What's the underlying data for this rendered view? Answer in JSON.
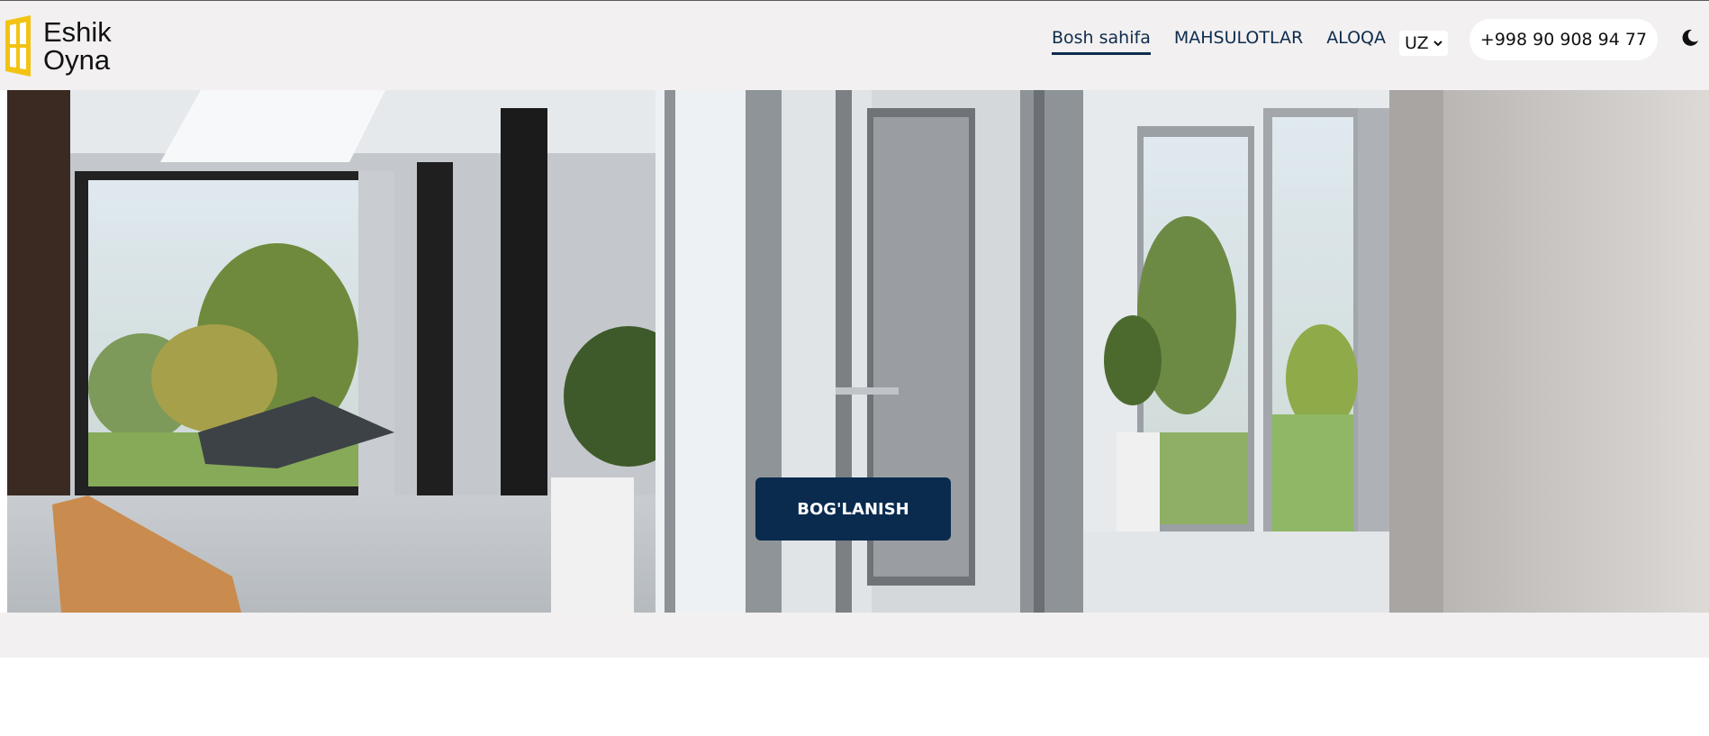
{
  "brand": {
    "line1": "Eshik",
    "line2": "Oyna",
    "accent": "#f3c313"
  },
  "nav": {
    "items": [
      {
        "label": "Bosh sahifa",
        "active": true
      },
      {
        "label": "MAHSULOTLAR",
        "active": false
      },
      {
        "label": "ALOQA",
        "active": false
      }
    ]
  },
  "language": {
    "selected": "UZ"
  },
  "phone": "+998 90 908 94 77",
  "theme_toggle_icon": "moon-icon",
  "hero": {
    "cta_label": "BOG'LANISH"
  },
  "colors": {
    "primary": "#0a2a4e",
    "header_bg": "#f2f0f0"
  }
}
